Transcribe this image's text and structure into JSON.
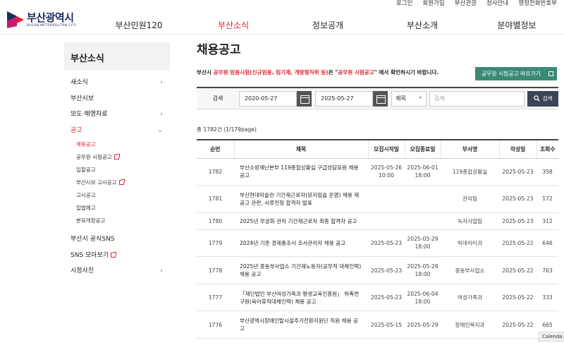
{
  "util_links": [
    "로그인",
    "회원가입",
    "부산관광",
    "청사안내",
    "행정전화번호부"
  ],
  "logo": {
    "ko": "부산광역시",
    "en": "BUSAN METROPOLITAN CITY"
  },
  "gnb": [
    "부산민원120",
    "부산소식",
    "정보공개",
    "부산소개",
    "분야별정보"
  ],
  "sidebar": {
    "title": "부산소식",
    "items": [
      "새소식",
      "부산시보",
      "보도·해명자료",
      "공고"
    ],
    "sub": [
      "채용공고",
      "공무원 시험공고",
      "입찰공고",
      "부산시보 고시공고",
      "고시공고",
      "입법예고",
      "분묘개장공고"
    ],
    "items2": [
      "부산시 공식SNS",
      "SNS 모아보기",
      "시정사진"
    ]
  },
  "content": {
    "title": "채용공고",
    "notice": {
      "a": "부산시 ",
      "b": "공무원 임용시험(신규임용, 임기제, 개방형직위 등)",
      "c": "은 \"",
      "d": "공무원 시험공고",
      "e": "\" 에서 확인하시기 바랍니다."
    },
    "exam_button": "공무원 시험공고 바로가기",
    "search": {
      "label": "검색",
      "date_from": "2020-05-27",
      "date_to": "2025-05-27",
      "tilde": "~",
      "select": "제목",
      "keyword_placeholder": "검색",
      "button": "검색"
    },
    "count": "총 1782건 (1/179page)",
    "columns": [
      "순번",
      "제목",
      "모집시작일",
      "모집종료일",
      "부서명",
      "작성일",
      "조회수"
    ],
    "rows": [
      {
        "no": "1782",
        "title": "부산소방재난본부 119종합상황실 구급상담요원 채용 공고",
        "start": "2025-05-26 10:00",
        "end": "2025-06-01 18:00",
        "dept": "119종합상황실",
        "date": "2025-05-23",
        "views": "358"
      },
      {
        "no": "1781",
        "title": "부산현대미술관 기간제근로자(뮤지엄숍 운영) 채용 재공고 관련, 서류전형 합격자 발표",
        "start": "",
        "end": "",
        "dept": "관리팀",
        "date": "2025-05-23",
        "views": "172"
      },
      {
        "no": "1780",
        "title": "2025년 무궁화 관리 기간제근로자 최종 합격자 공고",
        "start": "",
        "end": "",
        "dept": "녹지사업팀",
        "date": "2025-05-23",
        "views": "312"
      },
      {
        "no": "1779",
        "title": "2024년 기준 경제총조사 조사관리자 채용 공고",
        "start": "2025-05-23",
        "end": "2025-05-29 18:00",
        "dept": "빅데이터과",
        "date": "2025-05-22",
        "views": "646"
      },
      {
        "no": "1778",
        "title": "2025년 중동부사업소 기간제노동자(공무직 대체인력) 채용 공고",
        "start": "2025-05-23",
        "end": "2025-05-28 18:00",
        "dept": "중동부사업소",
        "date": "2025-05-22",
        "views": "763"
      },
      {
        "no": "1777",
        "title": "「재단법인 부산여성가족과 평생교육진흥원」 위촉연구원(육아휴직대체인력) 채용 공고",
        "start": "2025-05-23",
        "end": "2025-06-04 18:00",
        "dept": "여성가족과",
        "date": "2025-05-22",
        "views": "333"
      },
      {
        "no": "1776",
        "title": "부산광역시장애인탈시설주거전환지원단 직원 채용 공고",
        "start": "2025-05-15",
        "end": "2025-05-29",
        "dept": "장애인복지과",
        "date": "2025-05-22",
        "views": "665"
      }
    ]
  },
  "popup": "Calenda",
  "colors": {
    "accent_red": "#e0222f",
    "green_button": "#3a8a76",
    "dark_button": "#3b4556"
  }
}
